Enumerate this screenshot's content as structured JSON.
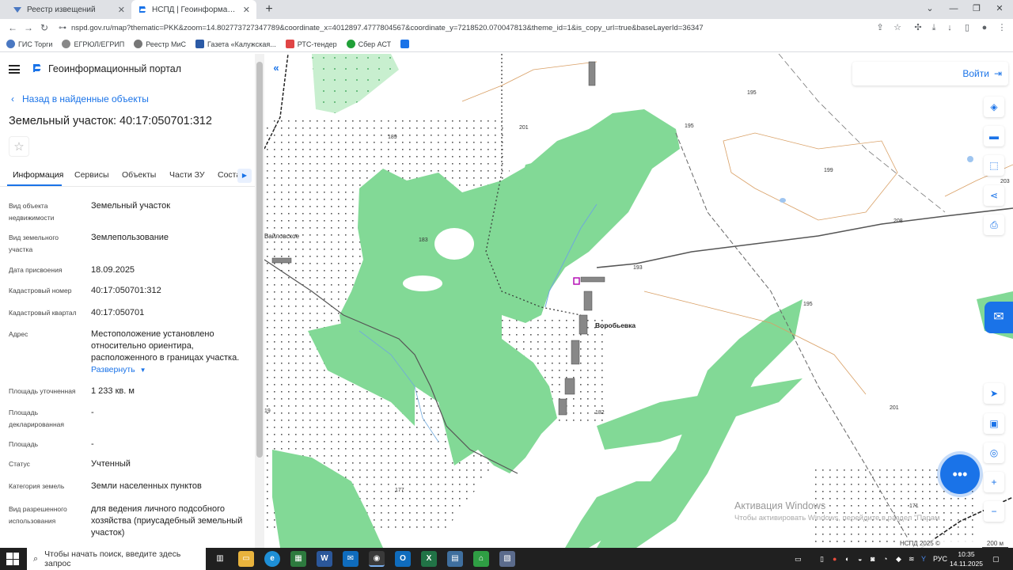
{
  "browser": {
    "tabs": [
      {
        "title": "Реестр извещений",
        "active": false
      },
      {
        "title": "НСПД | Геоинформационный п",
        "active": true
      }
    ],
    "url": "nspd.gov.ru/map?thematic=PKK&zoom=14.802773727347789&coordinate_x=4012897.4777804567&coordinate_y=7218520.070047813&theme_id=1&is_copy_url=true&baseLayerId=36347",
    "bookmarks": [
      "ГИС Торги",
      "ЕГРЮЛ/ЕГРИП",
      "Реестр МиС",
      "Газета «Калужская...",
      "РТС-тендер",
      "Сбер АСТ"
    ]
  },
  "panel": {
    "portal_title": "Геоинформационный портал",
    "back_label": "Назад в найденные объекты",
    "object_title": "Земельный участок: 40:17:050701:312",
    "tabs": [
      "Информация",
      "Сервисы",
      "Объекты",
      "Части ЗУ",
      "Соста"
    ],
    "fields": [
      {
        "label": "Вид объекта недвижимости",
        "value": "Земельный участок"
      },
      {
        "label": "Вид земельного участка",
        "value": "Землепользование"
      },
      {
        "label": "Дата присвоения",
        "value": "18.09.2025"
      },
      {
        "label": "Кадастровый номер",
        "value": "40:17:050701:312"
      },
      {
        "label": "Кадастровый квартал",
        "value": "40:17:050701"
      },
      {
        "label": "Адрес",
        "value": "Местоположение установлено относительно ориентира, расположенного в границах участка."
      },
      {
        "label": "Площадь уточненная",
        "value": "1 233 кв. м"
      },
      {
        "label": "Площадь декларированная",
        "value": "-"
      },
      {
        "label": "Площадь",
        "value": "-"
      },
      {
        "label": "Статус",
        "value": "Учтенный"
      },
      {
        "label": "Категория земель",
        "value": "Земли населенных пунктов"
      },
      {
        "label": "Вид разрешенного использования",
        "value": "для ведения личного подсобного хозяйства (приусадебный земельный участок)"
      }
    ],
    "expand_label": "Развернуть"
  },
  "map": {
    "login_label": "Войти",
    "village_label": "Воробьевка",
    "village2_label": "Байловское",
    "elevations": [
      "195",
      "201",
      "189",
      "199",
      "195",
      "183",
      "193",
      "208",
      "195",
      "182",
      "201",
      "177",
      "171",
      "203",
      "19"
    ],
    "windows_activation_title": "Активация Windows",
    "windows_activation_text": "Чтобы активировать Windows, перейдите в раздел \"Парам",
    "scale_left": "НСПД 2025 ©",
    "scale_right": "200 м"
  },
  "taskbar": {
    "search_placeholder": "Чтобы начать поиск, введите здесь запрос",
    "lang": "РУС",
    "time": "10:35",
    "date": "14.11.2025"
  },
  "colors": {
    "accent": "#1a73e8",
    "forest": "#82d996",
    "meadow": "#c8efcf"
  }
}
